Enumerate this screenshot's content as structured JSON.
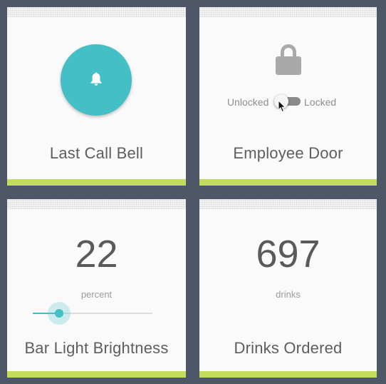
{
  "tiles": {
    "bell": {
      "title": "Last Call Bell",
      "icon": "bell-icon"
    },
    "door": {
      "title": "Employee Door",
      "icon": "lock-icon",
      "switch": {
        "left_label": "Unlocked",
        "right_label": "Locked",
        "state": "unlocked"
      }
    },
    "brightness": {
      "title": "Bar Light Brightness",
      "value": "22",
      "unit": "percent",
      "slider_fraction": 0.22
    },
    "drinks": {
      "title": "Drinks Ordered",
      "value": "697",
      "unit": "drinks"
    }
  },
  "colors": {
    "background": "#4d5768",
    "tile": "#fafafa",
    "accent_bar": "#c4dc5b",
    "teal": "#45bfc6",
    "lock_gray": "#a9a9a9",
    "text": "#5e5e5e"
  }
}
